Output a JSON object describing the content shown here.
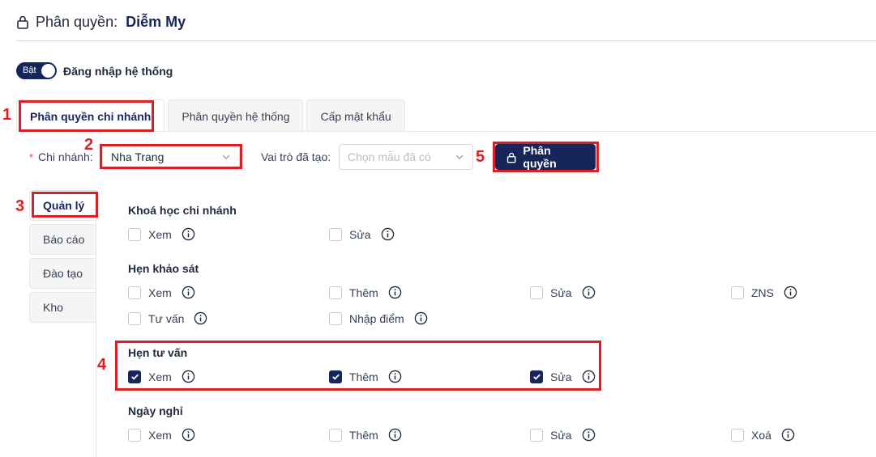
{
  "header": {
    "title_prefix": "Phân quyền:",
    "user_name": "Diễm My",
    "icon": "lock-icon"
  },
  "login_toggle": {
    "state_label": "Bật",
    "label": "Đăng nhập hệ thống",
    "on": true
  },
  "tabs": [
    {
      "label": "Phân quyền chi nhánh",
      "active": true
    },
    {
      "label": "Phân quyền hệ thống",
      "active": false
    },
    {
      "label": "Cấp mật khẩu",
      "active": false
    }
  ],
  "filters": {
    "required_mark": "*",
    "branch_label": "Chi nhánh:",
    "branch_value": "Nha Trang",
    "role_label": "Vai trò đã tạo:",
    "role_placeholder": "Chọn mẫu đã có",
    "submit_label": "Phân quyền"
  },
  "sidebar": [
    {
      "label": "Quản lý",
      "active": true
    },
    {
      "label": "Báo cáo",
      "active": false
    },
    {
      "label": "Đào tạo",
      "active": false
    },
    {
      "label": "Kho",
      "active": false
    }
  ],
  "groups": [
    {
      "title": "Khoá học chi nhánh",
      "perms": [
        {
          "label": "Xem",
          "checked": false
        },
        {
          "label": "Sửa",
          "checked": false
        }
      ]
    },
    {
      "title": "Hẹn khảo sát",
      "perms": [
        {
          "label": "Xem",
          "checked": false
        },
        {
          "label": "Thêm",
          "checked": false
        },
        {
          "label": "Sửa",
          "checked": false
        },
        {
          "label": "ZNS",
          "checked": false
        },
        {
          "label": "Tư vấn",
          "checked": false
        },
        {
          "label": "Nhập điểm",
          "checked": false
        }
      ]
    },
    {
      "title": "Hẹn tư vấn",
      "perms": [
        {
          "label": "Xem",
          "checked": true
        },
        {
          "label": "Thêm",
          "checked": true
        },
        {
          "label": "Sửa",
          "checked": true
        }
      ]
    },
    {
      "title": "Ngày nghỉ",
      "perms": [
        {
          "label": "Xem",
          "checked": false
        },
        {
          "label": "Thêm",
          "checked": false
        },
        {
          "label": "Sửa",
          "checked": false
        },
        {
          "label": "Xoá",
          "checked": false
        }
      ]
    }
  ],
  "annotations": [
    "1",
    "2",
    "3",
    "4",
    "5"
  ],
  "colors": {
    "primary": "#17265a",
    "annotation": "#e11d21",
    "required": "#ef4444"
  }
}
